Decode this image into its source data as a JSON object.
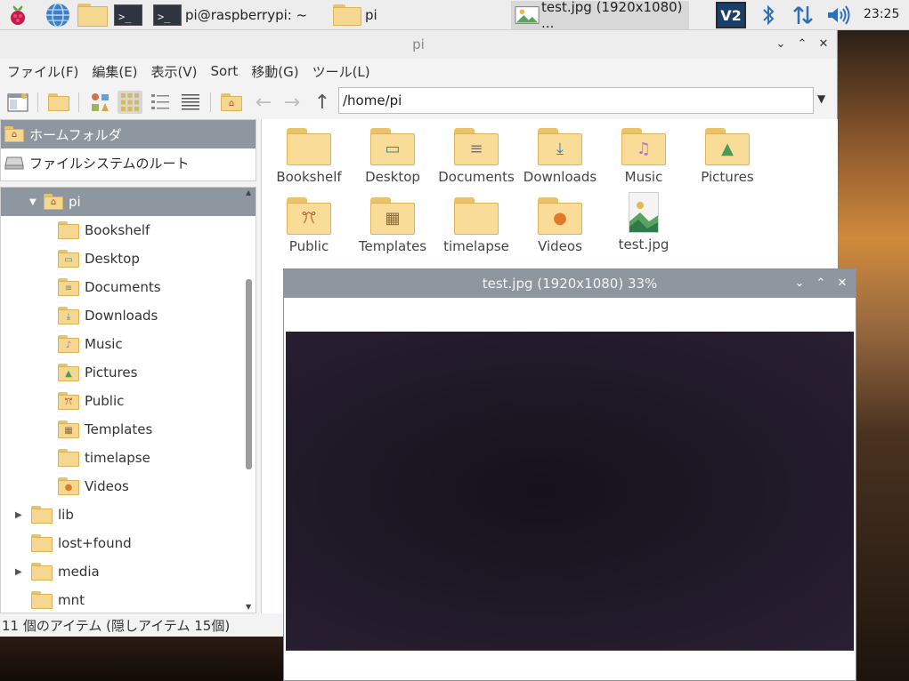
{
  "taskbar": {
    "tasks": [
      {
        "label": "pi@raspberrypi: ~"
      },
      {
        "label": "pi"
      },
      {
        "label": "test.jpg (1920x1080) ..."
      }
    ],
    "clock": "23:25"
  },
  "file_manager": {
    "title": "pi",
    "menu": [
      "ファイル(F)",
      "編集(E)",
      "表示(V)",
      "Sort",
      "移動(G)",
      "ツール(L)"
    ],
    "path": "/home/pi",
    "places": [
      {
        "label": "ホームフォルダ",
        "icon": "home-icon"
      },
      {
        "label": "ファイルシステムのルート",
        "icon": "drive-icon"
      }
    ],
    "tree": [
      {
        "label": "pi",
        "icon": "home-folder"
      },
      {
        "label": "Bookshelf",
        "icon": "folder"
      },
      {
        "label": "Desktop",
        "icon": "desktop-folder"
      },
      {
        "label": "Documents",
        "icon": "documents-folder"
      },
      {
        "label": "Downloads",
        "icon": "download-folder"
      },
      {
        "label": "Music",
        "icon": "music-folder"
      },
      {
        "label": "Pictures",
        "icon": "pictures-folder"
      },
      {
        "label": "Public",
        "icon": "public-folder"
      },
      {
        "label": "Templates",
        "icon": "templates-folder"
      },
      {
        "label": "timelapse",
        "icon": "folder"
      },
      {
        "label": "Videos",
        "icon": "videos-folder"
      },
      {
        "label": "lib",
        "icon": "folder"
      },
      {
        "label": "lost+found",
        "icon": "folder"
      },
      {
        "label": "media",
        "icon": "folder"
      },
      {
        "label": "mnt",
        "icon": "folder"
      }
    ],
    "items": [
      {
        "label": "Bookshelf"
      },
      {
        "label": "Desktop"
      },
      {
        "label": "Documents"
      },
      {
        "label": "Downloads"
      },
      {
        "label": "Music"
      },
      {
        "label": "Pictures"
      },
      {
        "label": "Public"
      },
      {
        "label": "Templates"
      },
      {
        "label": "timelapse"
      },
      {
        "label": "Videos"
      },
      {
        "label": "test.jpg"
      }
    ],
    "status": "11 個のアイテム (隠しアイテム 15個)"
  },
  "viewer": {
    "title": "test.jpg (1920x1080) 33%"
  },
  "colors": {
    "selection": "#8e96a0",
    "folder": "#f5d88f",
    "taskbar": "#ededed"
  }
}
